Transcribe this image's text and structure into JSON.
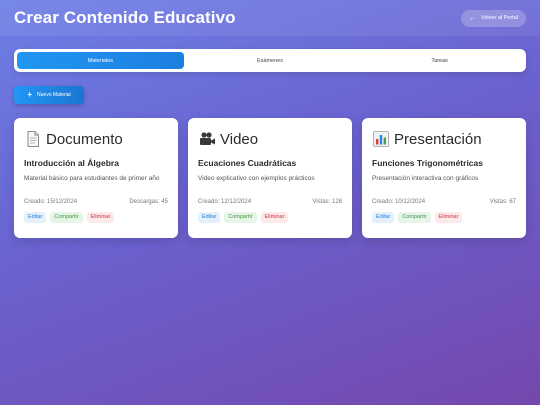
{
  "header": {
    "title": "Crear Contenido Educativo",
    "back_label": "Volver al Portal"
  },
  "tabs": [
    {
      "label": "Materiales",
      "active": true
    },
    {
      "label": "Exámenes",
      "active": false
    },
    {
      "label": "Tareas",
      "active": false
    }
  ],
  "new_button": {
    "label": "Nuevo Material"
  },
  "cards": [
    {
      "icon": "document-icon",
      "type": "Documento",
      "title": "Introducción al Álgebra",
      "description": "Material básico para estudiantes de primer año",
      "created": "Creado: 15/12/2024",
      "stat": "Descargas: 45",
      "actions": {
        "edit": "Editar",
        "share": "Compartir",
        "delete": "Eliminar"
      }
    },
    {
      "icon": "video-camera-icon",
      "type": "Video",
      "title": "Ecuaciones Cuadráticas",
      "description": "Video explicativo con ejemplos prácticos",
      "created": "Creado: 12/12/2024",
      "stat": "Vistas: 128",
      "actions": {
        "edit": "Editar",
        "share": "Compartir",
        "delete": "Eliminar"
      }
    },
    {
      "icon": "bar-chart-icon",
      "type": "Presentación",
      "title": "Funciones Trigonométricas",
      "description": "Presentación interactiva con gráficos",
      "created": "Creado: 10/12/2024",
      "stat": "Vistas: 67",
      "actions": {
        "edit": "Editar",
        "share": "Compartir",
        "delete": "Eliminar"
      }
    }
  ]
}
